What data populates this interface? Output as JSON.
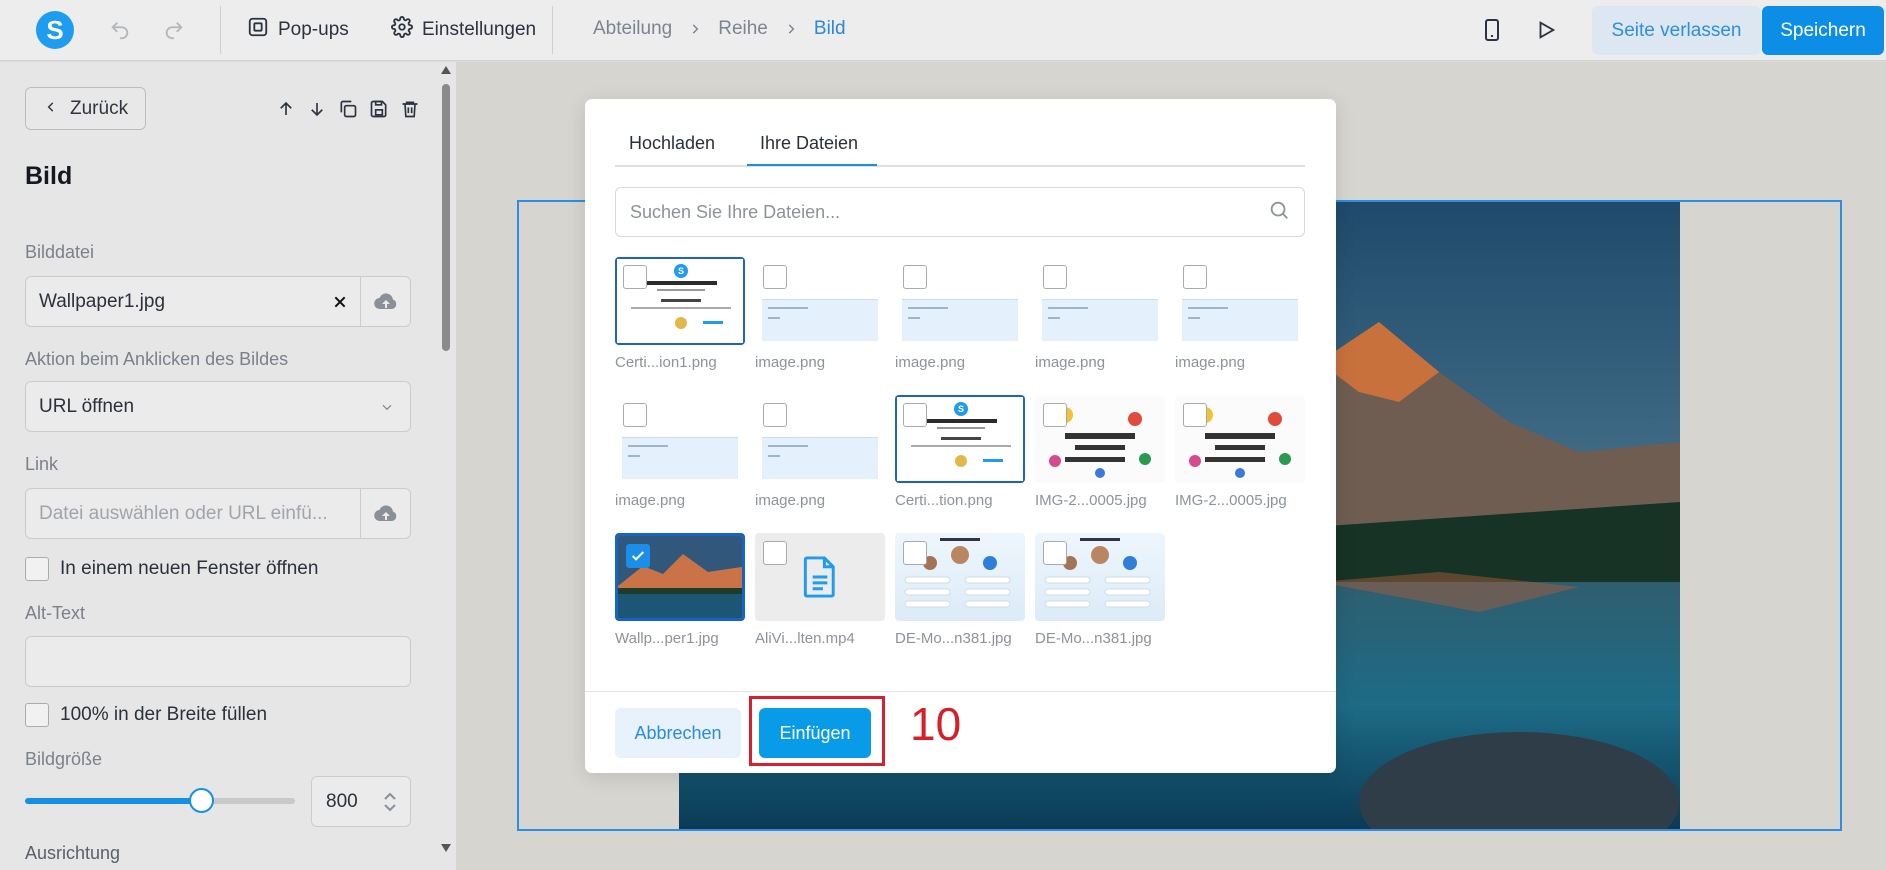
{
  "topbar": {
    "logo_letter": "S",
    "popups_label": "Pop-ups",
    "settings_label": "Einstellungen",
    "breadcrumb": [
      "Abteilung",
      "Reihe",
      "Bild"
    ],
    "leave_label": "Seite verlassen",
    "save_label": "Speichern"
  },
  "sidebar": {
    "back_label": "Zurück",
    "title": "Bild",
    "image_file_label": "Bilddatei",
    "image_file_value": "Wallpaper1.jpg",
    "click_action_label": "Aktion beim Anklicken des Bildes",
    "click_action_value": "URL öffnen",
    "link_label": "Link",
    "link_placeholder": "Datei auswählen oder URL einfü...",
    "new_window_label": "In einem neuen Fenster öffnen",
    "alt_text_label": "Alt-Text",
    "alt_text_value": "",
    "full_width_label": "100% in der Breite füllen",
    "size_label": "Bildgröße",
    "size_value": "800",
    "size_fraction": 0.65,
    "alignment_label": "Ausrichtung"
  },
  "modal": {
    "tabs": [
      "Hochladen",
      "Ihre Dateien"
    ],
    "active_tab": "Ihre Dateien",
    "search_placeholder": "Suchen Sie Ihre Dateien...",
    "files": [
      {
        "name": "Certi...ion1.png",
        "kind": "certificate",
        "checked": false
      },
      {
        "name": "image.png",
        "kind": "doc",
        "checked": false
      },
      {
        "name": "image.png",
        "kind": "doc",
        "checked": false
      },
      {
        "name": "image.png",
        "kind": "doc",
        "checked": false
      },
      {
        "name": "image.png",
        "kind": "doc",
        "checked": false
      },
      {
        "name": "image.png",
        "kind": "doc",
        "checked": false
      },
      {
        "name": "image.png",
        "kind": "doc",
        "checked": false
      },
      {
        "name": "Certi...tion.png",
        "kind": "certificate",
        "checked": false
      },
      {
        "name": "IMG-2...0005.jpg",
        "kind": "birthday",
        "checked": false
      },
      {
        "name": "IMG-2...0005.jpg",
        "kind": "birthday",
        "checked": false
      },
      {
        "name": "Wallp...per1.jpg",
        "kind": "landscape",
        "checked": true
      },
      {
        "name": "AliVi...lten.mp4",
        "kind": "video",
        "checked": false
      },
      {
        "name": "DE-Mo...n381.jpg",
        "kind": "ranking",
        "checked": false
      },
      {
        "name": "DE-Mo...n381.jpg",
        "kind": "ranking",
        "checked": false
      }
    ],
    "cancel_label": "Abbrechen",
    "insert_label": "Einfügen"
  },
  "annotation": {
    "step_number": "10",
    "color": "#d7202f"
  },
  "colors": {
    "accent": "#1590e6",
    "save_button": "#0c8ee6"
  }
}
